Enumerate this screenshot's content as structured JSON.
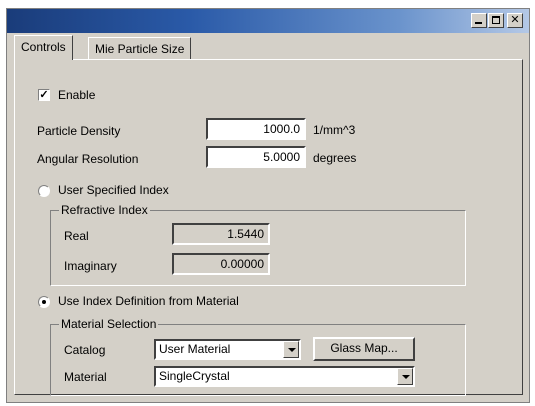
{
  "tabs": [
    {
      "label": "Controls"
    },
    {
      "label": "Mie Particle Size"
    }
  ],
  "controls": {
    "enable": {
      "label": "Enable",
      "checked": true
    },
    "particle_density": {
      "label": "Particle Density",
      "value": "1000.0",
      "unit": "1/mm^3"
    },
    "angular_resolution": {
      "label": "Angular Resolution",
      "value": "5.0000",
      "unit": "degrees"
    },
    "user_specified_index": {
      "label": "User Specified Index",
      "selected": false
    },
    "refractive_index": {
      "title": "Refractive Index",
      "real": {
        "label": "Real",
        "value": "1.5440"
      },
      "imaginary": {
        "label": "Imaginary",
        "value": "0.00000"
      }
    },
    "use_index_material": {
      "label": "Use Index Definition from Material",
      "selected": true
    },
    "material_selection": {
      "title": "Material Selection",
      "catalog": {
        "label": "Catalog",
        "value": "User Material"
      },
      "glass_map_label": "Glass Map...",
      "material": {
        "label": "Material",
        "value": "SingleCrystal"
      }
    }
  }
}
